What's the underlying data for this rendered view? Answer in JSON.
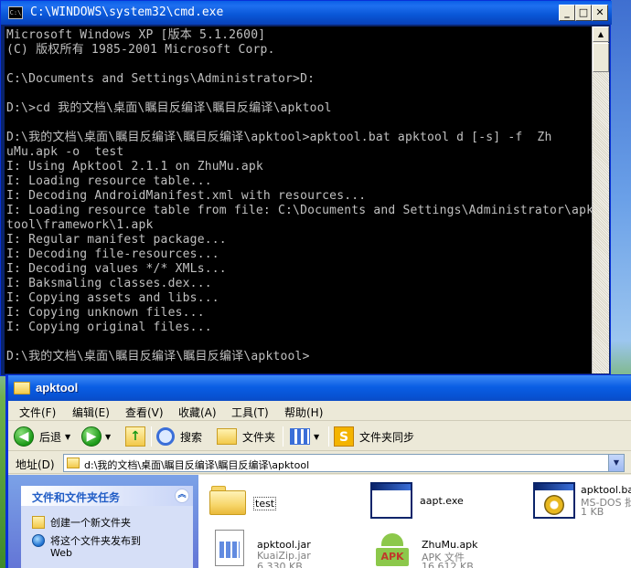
{
  "cmd": {
    "title": "C:\\WINDOWS\\system32\\cmd.exe",
    "icon_label": "C:\\",
    "lines": [
      "Microsoft Windows XP [版本 5.1.2600]",
      "(C) 版权所有 1985-2001 Microsoft Corp.",
      "",
      "C:\\Documents and Settings\\Administrator>D:",
      "",
      "D:\\>cd 我的文档\\桌面\\瞩目反编译\\瞩目反编译\\apktool",
      "",
      "D:\\我的文档\\桌面\\瞩目反编译\\瞩目反编译\\apktool>apktool.bat apktool d [-s] -f  Zh",
      "uMu.apk -o  test",
      "I: Using Apktool 2.1.1 on ZhuMu.apk",
      "I: Loading resource table...",
      "I: Decoding AndroidManifest.xml with resources...",
      "I: Loading resource table from file: C:\\Documents and Settings\\Administrator\\apk",
      "tool\\framework\\1.apk",
      "I: Regular manifest package...",
      "I: Decoding file-resources...",
      "I: Decoding values */* XMLs...",
      "I: Baksmaling classes.dex...",
      "I: Copying assets and libs...",
      "I: Copying unknown files...",
      "I: Copying original files...",
      "",
      "D:\\我的文档\\桌面\\瞩目反编译\\瞩目反编译\\apktool>"
    ],
    "buttons": {
      "minimize": "_",
      "maximize": "□",
      "close": "✕"
    }
  },
  "explorer": {
    "title": "apktool",
    "menu": [
      "文件(F)",
      "编辑(E)",
      "查看(V)",
      "收藏(A)",
      "工具(T)",
      "帮助(H)"
    ],
    "toolbar": {
      "back": "后退",
      "search": "搜索",
      "folders": "文件夹",
      "sync": "文件夹同步"
    },
    "address_label": "地址(D)",
    "address_value": "d:\\我的文档\\桌面\\瞩目反编译\\瞩目反编译\\apktool",
    "tasks": {
      "title": "文件和文件夹任务",
      "items": [
        "创建一个新文件夹",
        "将这个文件夹发布到",
        "Web"
      ]
    },
    "files": [
      {
        "name": "test",
        "kind": "folder"
      },
      {
        "name": "aapt.exe",
        "kind": "exe"
      },
      {
        "name": "apktool.ba",
        "sub1": "MS-DOS 批处",
        "sub2": "1 KB",
        "kind": "bat"
      },
      {
        "name": "apktool.jar",
        "sub1": "KuaiZip.jar",
        "sub2": "6,330 KB",
        "kind": "jar"
      },
      {
        "name": "ZhuMu.apk",
        "sub1": "APK 文件",
        "sub2": "16,612 KB",
        "kind": "apk"
      }
    ]
  }
}
